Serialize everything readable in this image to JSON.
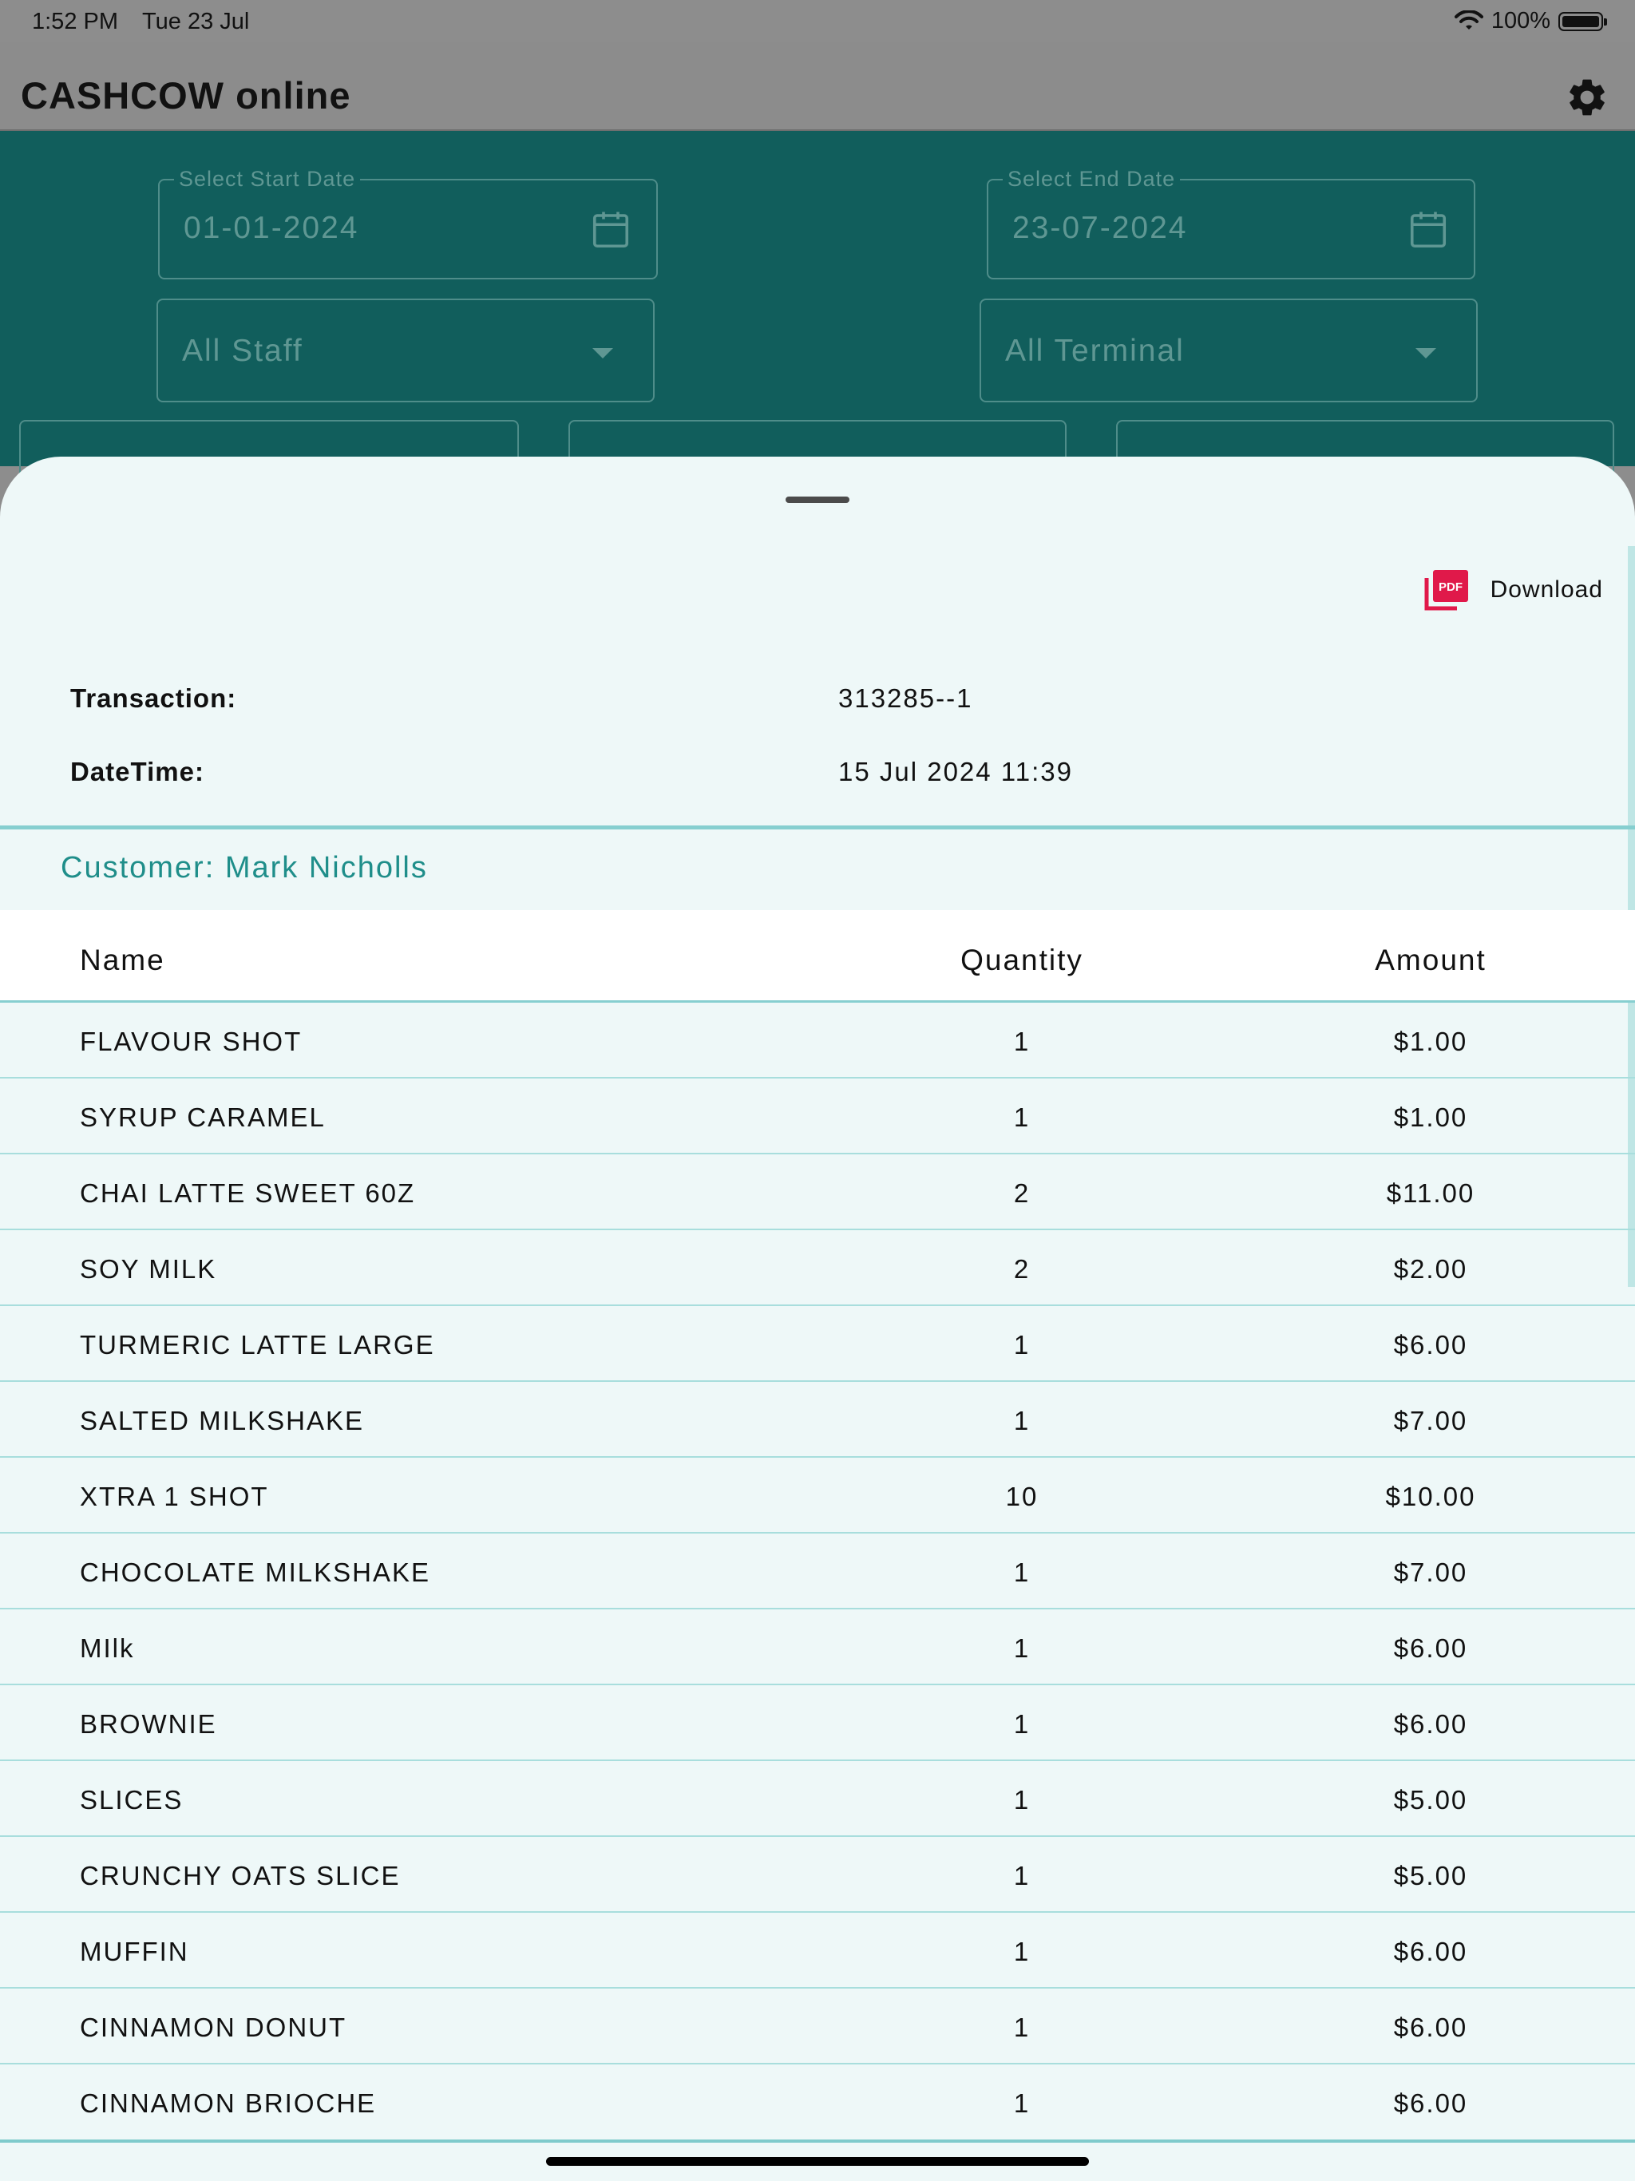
{
  "status_bar": {
    "time": "1:52 PM",
    "date": "Tue 23 Jul",
    "battery": "100%"
  },
  "app_bar": {
    "title": "CASHCOW online",
    "settings_icon": "gear-icon"
  },
  "filters": {
    "start_date": {
      "label": "Select Start Date",
      "value": "01-01-2024",
      "icon": "calendar-icon"
    },
    "end_date": {
      "label": "Select End Date",
      "value": "23-07-2024",
      "icon": "calendar-icon"
    },
    "staff": {
      "value": "All Staff"
    },
    "terminal": {
      "value": "All Terminal"
    }
  },
  "sheet": {
    "download_label": "Download",
    "download_icon": "pdf-icon",
    "transaction_label": "Transaction:",
    "transaction_value": "313285--1",
    "datetime_label": "DateTime:",
    "datetime_value": "15 Jul 2024 11:39",
    "customer": "Customer: Mark Nicholls",
    "columns": {
      "name": "Name",
      "quantity": "Quantity",
      "amount": "Amount"
    },
    "items": [
      {
        "name": "FLAVOUR SHOT",
        "quantity": "1",
        "amount": "$1.00"
      },
      {
        "name": "SYRUP CARAMEL",
        "quantity": "1",
        "amount": "$1.00"
      },
      {
        "name": "CHAI LATTE SWEET 60Z",
        "quantity": "2",
        "amount": "$11.00"
      },
      {
        "name": "SOY MILK",
        "quantity": "2",
        "amount": "$2.00"
      },
      {
        "name": "TURMERIC LATTE LARGE",
        "quantity": "1",
        "amount": "$6.00"
      },
      {
        "name": "SALTED MILKSHAKE",
        "quantity": "1",
        "amount": "$7.00"
      },
      {
        "name": "XTRA 1 SHOT",
        "quantity": "10",
        "amount": "$10.00"
      },
      {
        "name": "CHOCOLATE MILKSHAKE",
        "quantity": "1",
        "amount": "$7.00"
      },
      {
        "name": "MIlk",
        "quantity": "1",
        "amount": "$6.00"
      },
      {
        "name": "BROWNIE",
        "quantity": "1",
        "amount": "$6.00"
      },
      {
        "name": "SLICES",
        "quantity": "1",
        "amount": "$5.00"
      },
      {
        "name": "CRUNCHY OATS SLICE",
        "quantity": "1",
        "amount": "$5.00"
      },
      {
        "name": "MUFFIN",
        "quantity": "1",
        "amount": "$6.00"
      },
      {
        "name": "CINNAMON DONUT",
        "quantity": "1",
        "amount": "$6.00"
      },
      {
        "name": "CINNAMON BRIOCHE",
        "quantity": "1",
        "amount": "$6.00"
      }
    ]
  },
  "colors": {
    "teal_dark": "#115e5c",
    "teal_accent": "#1f8e8a",
    "divider": "#86cfd0",
    "pdf_red": "#e0194a"
  }
}
